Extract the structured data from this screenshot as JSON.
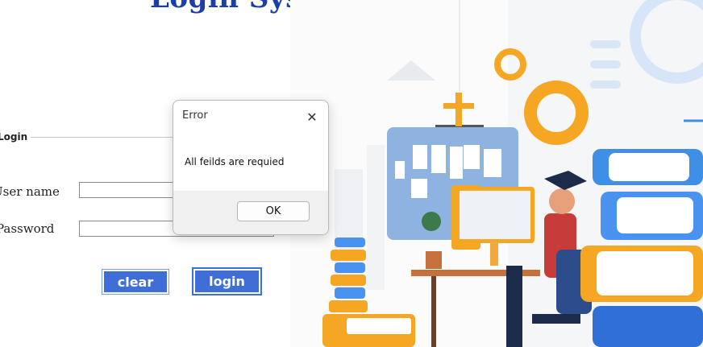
{
  "page": {
    "title": "Login System"
  },
  "login": {
    "legend": "Login",
    "username_label": "User name",
    "password_label": "Password",
    "username_value": "",
    "password_value": "",
    "clear_label": "clear",
    "login_label": "login"
  },
  "dialog": {
    "title": "Error",
    "close_icon": "close-icon",
    "message": "All feilds are requied",
    "ok_label": "OK"
  },
  "colors": {
    "title": "#1b3fa6",
    "button": "#3f6fd6"
  }
}
